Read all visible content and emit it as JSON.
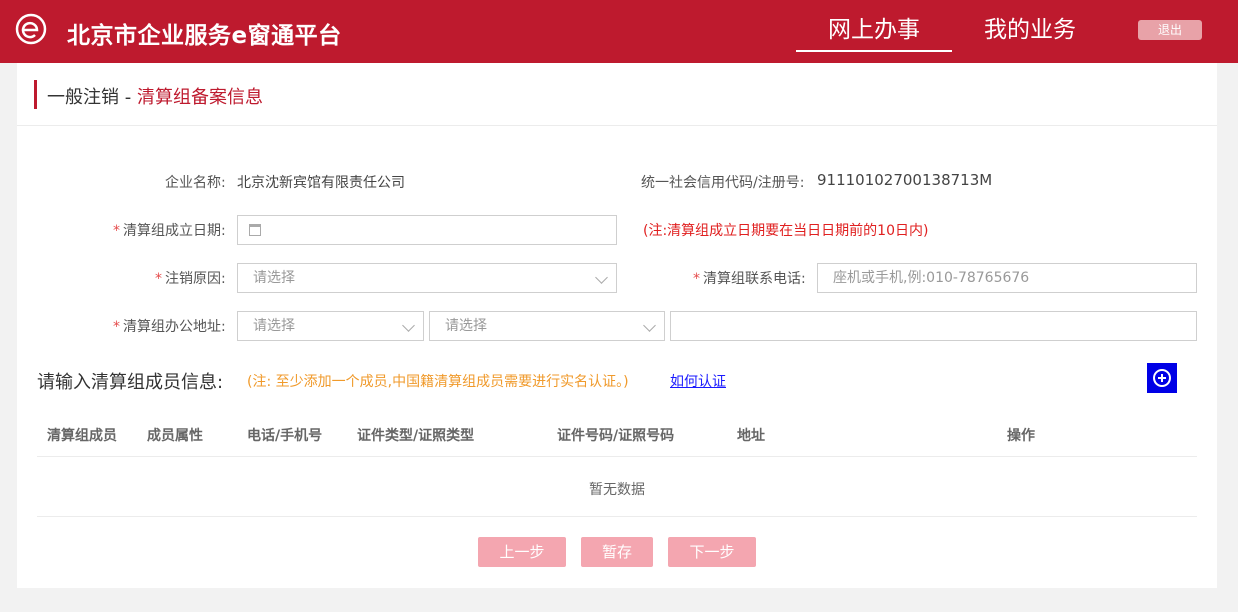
{
  "header": {
    "logo_icon": "e-logo-icon",
    "title": "北京市企业服务e窗通平台",
    "nav": {
      "online": "网上办事",
      "mine": "我的业务"
    },
    "logout": "退出",
    "brand_color": "#be1a2e"
  },
  "breadcrumb": {
    "parent": "一般注销",
    "separator": " - ",
    "current": "清算组备案信息"
  },
  "company": {
    "name_label": "企业名称:",
    "name_value": "北京沈新宾馆有限责任公司",
    "code_label": "统一社会信用代码/注册号:",
    "code_value": "91110102700138713M"
  },
  "form": {
    "required_mark": "*",
    "date_label": "清算组成立日期:",
    "date_icon": "calendar-icon",
    "date_note": "(注:清算组成立日期要在当日日期前的10日内)",
    "reason_label": "注销原因:",
    "reason_placeholder": "请选择",
    "phone_label": "清算组联系电话:",
    "phone_placeholder": "座机或手机,例:010-78765676",
    "address_label": "清算组办公地址:",
    "address_select1": "请选择",
    "address_select2": "请选择",
    "address_detail": ""
  },
  "members": {
    "title": "请输入清算组成员信息:",
    "note": "(注: 至少添加一个成员,中国籍清算组成员需要进行实名认证。)",
    "link": "如何认证",
    "add_icon": "plus-circle-icon",
    "columns": [
      "清算组成员",
      "成员属性",
      "电话/手机号",
      "证件类型/证照类型",
      "证件号码/证照号码",
      "地址",
      "操作"
    ],
    "empty_text": "暂无数据"
  },
  "actions": {
    "prev": "上一步",
    "save": "暂存",
    "next": "下一步"
  }
}
